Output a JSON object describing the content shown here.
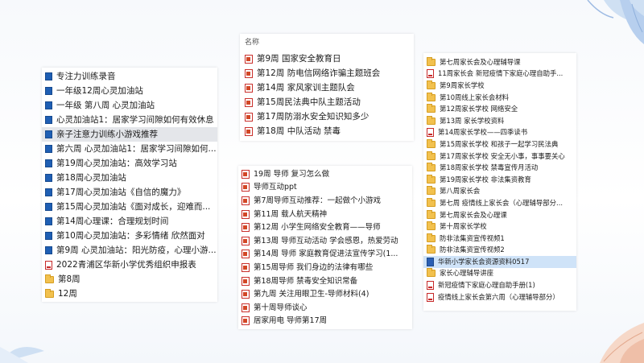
{
  "left_panel": {
    "items": [
      {
        "icon": "folder-blue",
        "label": "专注力训练录音"
      },
      {
        "icon": "folder-blue",
        "label": "一年级12周心灵加油站"
      },
      {
        "icon": "folder-blue",
        "label": "一年级 第八周  心灵加油站"
      },
      {
        "icon": "folder-blue",
        "label": "心灵加油站1：居家学习间隙如何有效休息"
      },
      {
        "icon": "folder-blue",
        "label": "亲子注意力训练小游戏推荐"
      },
      {
        "icon": "folder-blue",
        "label": "第六周 心灵加油站1：居家学习间隙如何..."
      },
      {
        "icon": "folder-blue",
        "label": "第19周心灵加油站：高效学习站"
      },
      {
        "icon": "folder-blue",
        "label": "第18周心灵加油站"
      },
      {
        "icon": "folder-blue",
        "label": "第17周心灵加油站《自信的魔力》"
      },
      {
        "icon": "folder-blue",
        "label": "第15周心灵加油站《面对成长，迎难而..."
      },
      {
        "icon": "folder-blue",
        "label": "第14周心理课：合理规划时间"
      },
      {
        "icon": "folder-blue",
        "label": "第10周心灵加油站：多彩情绪 欣然面对"
      },
      {
        "icon": "folder-blue",
        "label": "第9周 心灵加油站：阳光防疫，心理小游..."
      },
      {
        "icon": "pdf",
        "label": "2022青浦区华新小学优秀组织申报表"
      },
      {
        "icon": "folder-yellow",
        "label": "第8周"
      },
      {
        "icon": "folder-yellow",
        "label": "12周"
      }
    ]
  },
  "mid_top_panel": {
    "header": "名称",
    "items": [
      {
        "icon": "ppt",
        "label": "第9周 国家安全教育日"
      },
      {
        "icon": "ppt",
        "label": "第12周 防电信网络诈骗主题班会"
      },
      {
        "icon": "ppt",
        "label": "第14周 家风家训主题队会"
      },
      {
        "icon": "ppt",
        "label": "第15周民法典中队主题活动"
      },
      {
        "icon": "ppt",
        "label": "第17周防溺水安全知识知多少"
      },
      {
        "icon": "ppt",
        "label": "第18周 中队活动  禁毒"
      }
    ]
  },
  "mid_bottom_panel": {
    "items": [
      {
        "icon": "ppt",
        "label": "19周  导师  复习怎么做"
      },
      {
        "icon": "ppt",
        "label": "导师互动ppt"
      },
      {
        "icon": "ppt",
        "label": "第7周导师互动推荐：一起做个小游戏"
      },
      {
        "icon": "ppt",
        "label": "第11周 载人航天精神"
      },
      {
        "icon": "ppt",
        "label": "第12周 小学生网络安全教育——导师"
      },
      {
        "icon": "ppt",
        "label": "第13周 导师互动活动 学会感恩，热爱劳动"
      },
      {
        "icon": "ppt",
        "label": "第14周  导师 家庭教育促进法宣传学习(1..."
      },
      {
        "icon": "ppt",
        "label": "第15周导师 我们身边的法律有哪些"
      },
      {
        "icon": "ppt",
        "label": "第18周导师  禁毒安全知识常备"
      },
      {
        "icon": "ppt",
        "label": "第九周 关注用眼卫生-导师材料(4)"
      },
      {
        "icon": "ppt",
        "label": "第十周导师谈心"
      },
      {
        "icon": "ppt",
        "label": "居家用电  导师第17周"
      }
    ]
  },
  "right_panel": {
    "items": [
      {
        "icon": "folder-yellow",
        "label": "第七周家长会及心理辅导课"
      },
      {
        "icon": "pdf",
        "label": "11周家长会 新冠疫情下家庭心理自助手..."
      },
      {
        "icon": "folder-yellow",
        "label": "第9周家长学校"
      },
      {
        "icon": "folder-yellow",
        "label": "第10周线上家长会材料"
      },
      {
        "icon": "folder-yellow",
        "label": "第12周家长学校  网络安全"
      },
      {
        "icon": "folder-yellow",
        "label": "第13周  家长学校资料"
      },
      {
        "icon": "pdf",
        "label": "第14周家长学校——四季读书"
      },
      {
        "icon": "folder-yellow",
        "label": "第15周家长学校 和孩子一起学习民法典"
      },
      {
        "icon": "folder-yellow",
        "label": "第17周家长学校 安全无小事，事事要关心"
      },
      {
        "icon": "folder-yellow",
        "label": "第18周家长学校 禁毒宣传月活动"
      },
      {
        "icon": "folder-yellow",
        "label": "第19周家长学校  非法集资教育"
      },
      {
        "icon": "folder-yellow",
        "label": "第八周家长会"
      },
      {
        "icon": "folder-yellow",
        "label": "第七周 疫情线上家长会（心理辅导部分..."
      },
      {
        "icon": "folder-yellow",
        "label": "第七周家长会及心理课"
      },
      {
        "icon": "folder-yellow",
        "label": "第十周家长学校"
      },
      {
        "icon": "folder-yellow",
        "label": "防非法集资宣传视频1"
      },
      {
        "icon": "folder-yellow",
        "label": "防非法集资宣传视频2"
      },
      {
        "icon": "word",
        "label": "华新小学家长会资源资料0517"
      },
      {
        "icon": "folder-yellow",
        "label": "家长心理辅导讲座"
      },
      {
        "icon": "pdf",
        "label": "新冠疫情下家庭心理自助手册(1)"
      },
      {
        "icon": "pdf",
        "label": "疫情线上家长会第六周（心理辅导部分）"
      }
    ]
  },
  "colors": {
    "accent": "#1f5fb4",
    "ppt": "#d24726",
    "pdf": "#c62828",
    "folder": "#f2c14e",
    "selected": "#e4e6ea",
    "selected_blue": "#cfe3f8"
  },
  "selection": {
    "left_panel_index": 4,
    "right_panel_index": 17
  }
}
